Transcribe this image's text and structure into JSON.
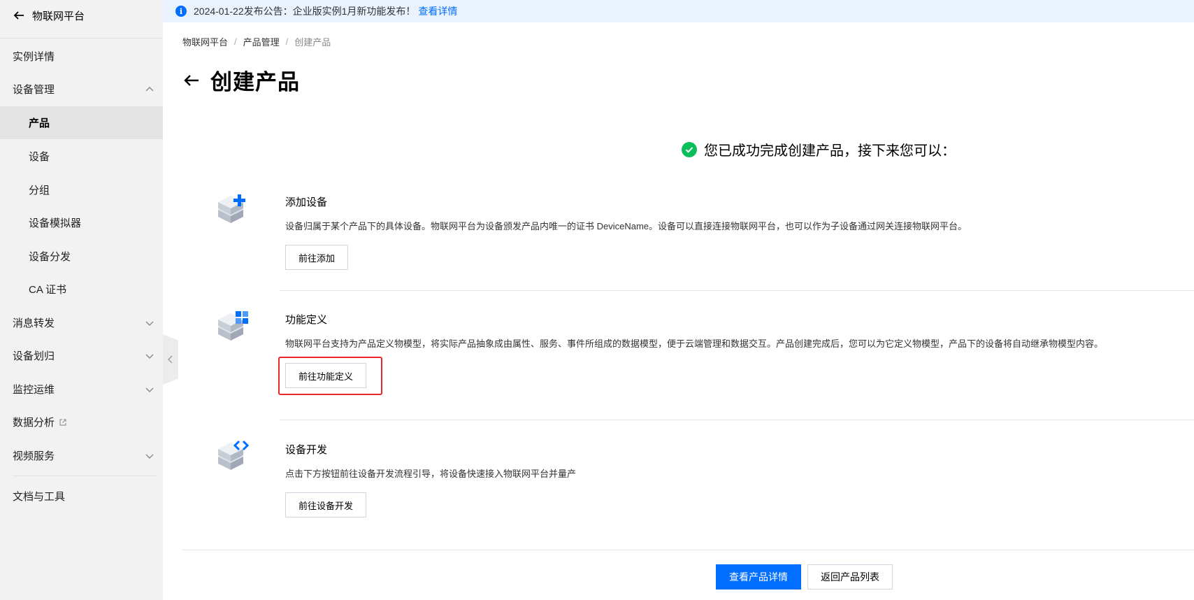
{
  "sidebar": {
    "header": "物联网平台",
    "items": [
      {
        "label": "实例详情"
      },
      {
        "label": "设备管理"
      },
      {
        "label": "产品"
      },
      {
        "label": "设备"
      },
      {
        "label": "分组"
      },
      {
        "label": "设备模拟器"
      },
      {
        "label": "设备分发"
      },
      {
        "label": "CA 证书"
      },
      {
        "label": "消息转发"
      },
      {
        "label": "设备划归"
      },
      {
        "label": "监控运维"
      },
      {
        "label": "数据分析"
      },
      {
        "label": "视频服务"
      },
      {
        "label": "文档与工具"
      }
    ]
  },
  "notice": {
    "text": "2024-01-22发布公告：企业版实例1月新功能发布！",
    "link": "查看详情"
  },
  "breadcrumb": [
    "物联网平台",
    "产品管理",
    "创建产品"
  ],
  "page_title": "创建产品",
  "success_message": "您已成功完成创建产品，接下来您可以：",
  "steps": [
    {
      "title": "添加设备",
      "desc": "设备归属于某个产品下的具体设备。物联网平台为设备颁发产品内唯一的证书 DeviceName。设备可以直接连接物联网平台，也可以作为子设备通过网关连接物联网平台。",
      "button": "前往添加"
    },
    {
      "title": "功能定义",
      "desc": "物联网平台支持为产品定义物模型，将实际产品抽象成由属性、服务、事件所组成的数据模型，便于云端管理和数据交互。产品创建完成后，您可以为它定义物模型，产品下的设备将自动继承物模型内容。",
      "button": "前往功能定义"
    },
    {
      "title": "设备开发",
      "desc": "点击下方按钮前往设备开发流程引导，将设备快速接入物联网平台并量产",
      "button": "前往设备开发"
    }
  ],
  "footer": {
    "primary": "查看产品详情",
    "secondary": "返回产品列表"
  },
  "colors": {
    "accent": "#006eff",
    "success": "#0abf5b",
    "highlight": "#e8262c",
    "sidebar_bg": "#f2f2f2"
  }
}
